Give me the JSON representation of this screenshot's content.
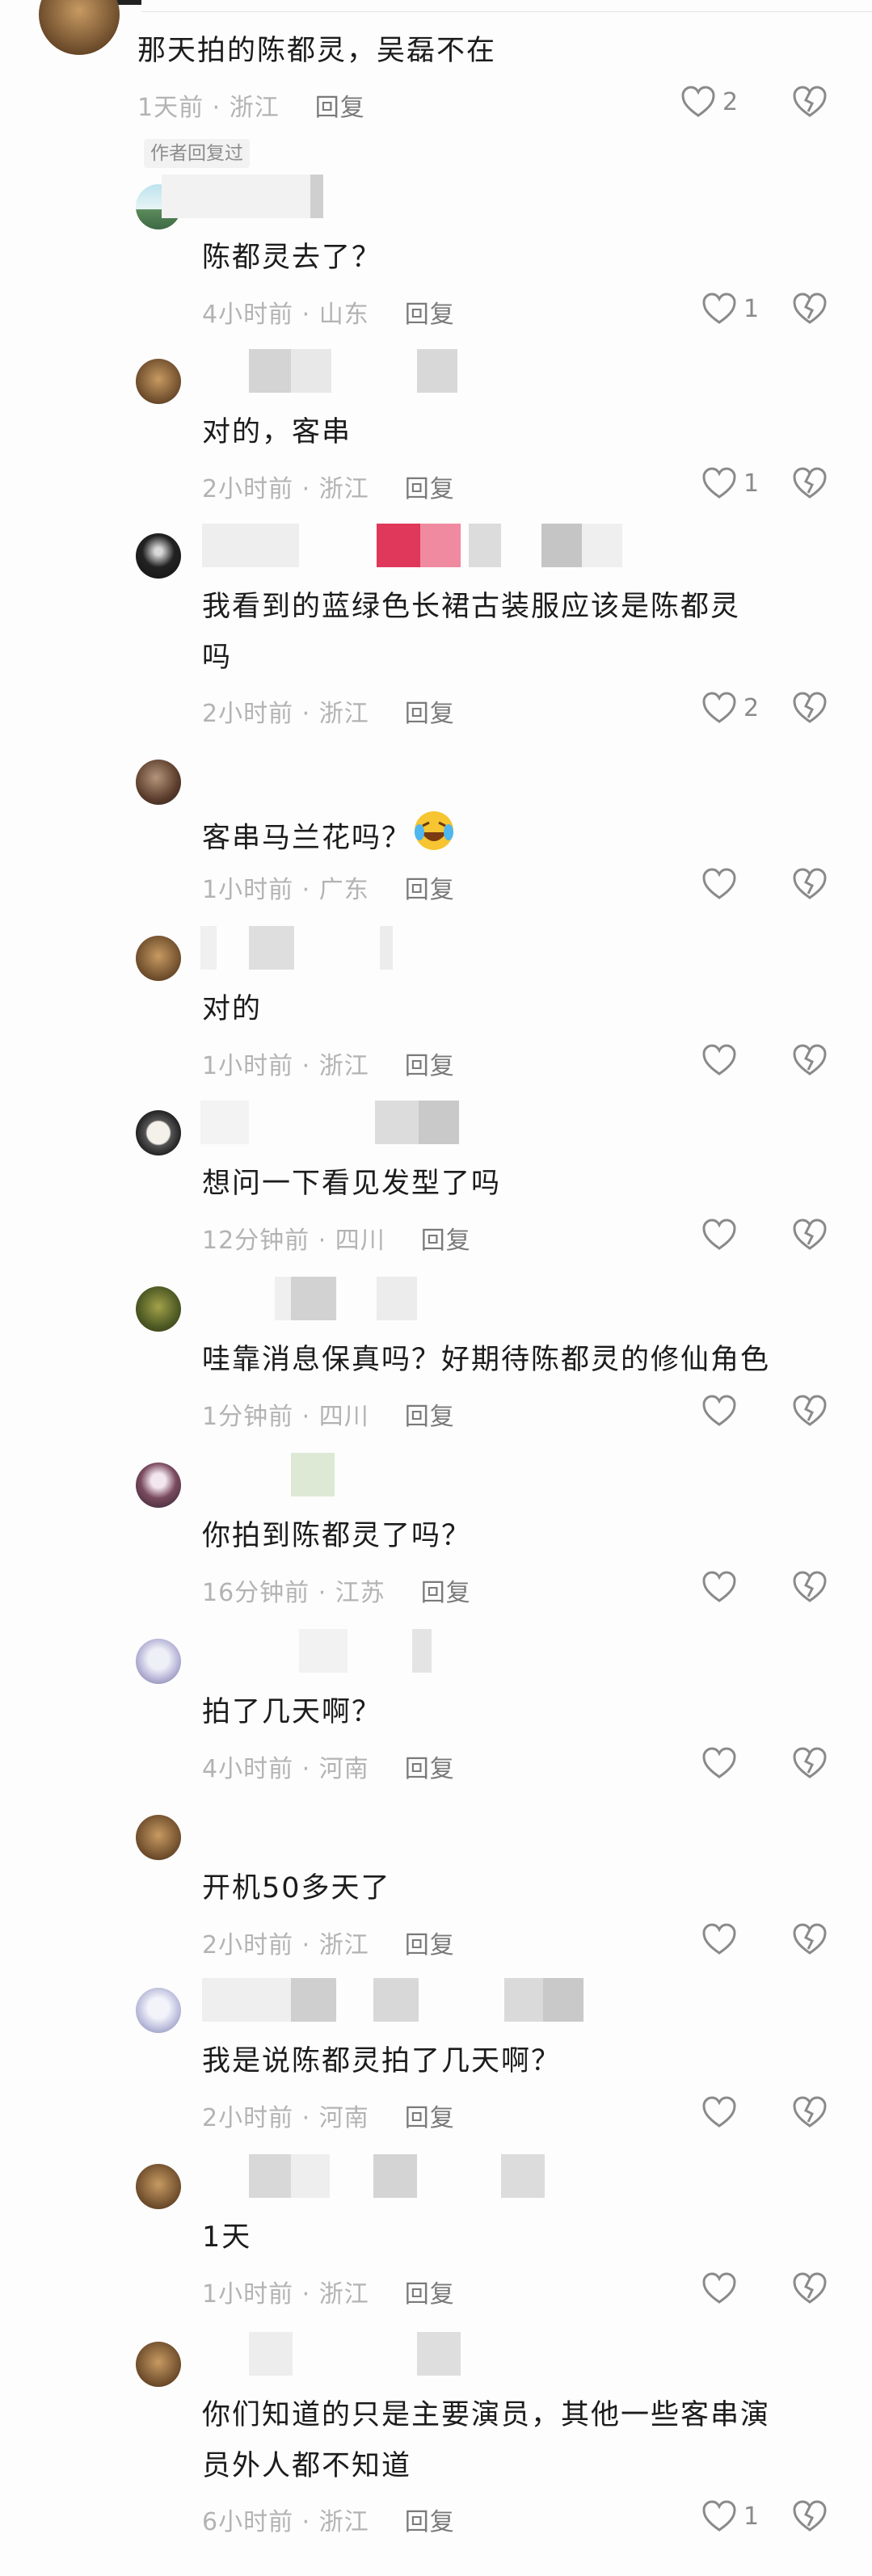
{
  "top_comment": {
    "text": "那天拍的陈都灵，吴磊不在",
    "time": "1天前",
    "location": "浙江",
    "reply_label": "回复",
    "likes": "2"
  },
  "author_tag": "作者回复过",
  "replies": [
    {
      "text": "陈都灵去了？",
      "time": "4小时前",
      "location": "山东",
      "reply_label": "回复",
      "likes": "1"
    },
    {
      "text": "对的，客串",
      "time": "2小时前",
      "location": "浙江",
      "reply_label": "回复",
      "likes": "1"
    },
    {
      "text": "我看到的蓝绿色长裙古装服应该是陈都灵\n吗",
      "time": "2小时前",
      "location": "浙江",
      "reply_label": "回复",
      "likes": "2"
    },
    {
      "text": "客串马兰花吗？",
      "time": "1小时前",
      "location": "广东",
      "reply_label": "回复",
      "likes": ""
    },
    {
      "text": "对的",
      "time": "1小时前",
      "location": "浙江",
      "reply_label": "回复",
      "likes": ""
    },
    {
      "text": "想问一下看见发型了吗",
      "time": "12分钟前",
      "location": "四川",
      "reply_label": "回复",
      "likes": ""
    },
    {
      "text": "哇靠消息保真吗？好期待陈都灵的修仙角色",
      "time": "1分钟前",
      "location": "四川",
      "reply_label": "回复",
      "likes": ""
    },
    {
      "text": "你拍到陈都灵了吗？",
      "time": "16分钟前",
      "location": "江苏",
      "reply_label": "回复",
      "likes": ""
    },
    {
      "text": "拍了几天啊？",
      "time": "4小时前",
      "location": "河南",
      "reply_label": "回复",
      "likes": ""
    },
    {
      "text": "开机50多天了",
      "time": "2小时前",
      "location": "浙江",
      "reply_label": "回复",
      "likes": ""
    },
    {
      "text": "我是说陈都灵拍了几天啊？",
      "time": "2小时前",
      "location": "河南",
      "reply_label": "回复",
      "likes": ""
    },
    {
      "text": "1天",
      "time": "1小时前",
      "location": "浙江",
      "reply_label": "回复",
      "likes": ""
    },
    {
      "text": "你们知道的只是主要演员，其他一些客串演\n员外人都不知道",
      "time": "6小时前",
      "location": "浙江",
      "reply_label": "回复",
      "likes": "1"
    }
  ],
  "meta_separator": " · ",
  "emoji_name": "laughing-crying-emoji-icon",
  "colors": {
    "text": "#1c1c1c",
    "meta": "#b3b3b3",
    "reply": "#7a7a7a",
    "icon": "#8a8a8a",
    "background": "#fdfdfd"
  }
}
